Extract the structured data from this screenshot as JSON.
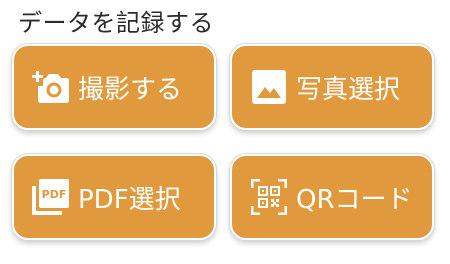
{
  "header": {
    "title": "データを記録する"
  },
  "buttons": {
    "camera": {
      "label": "撮影する",
      "icon": "add-camera-icon"
    },
    "photo": {
      "label": "写真選択",
      "icon": "image-icon"
    },
    "pdf": {
      "label": "PDF選択",
      "icon": "pdf-icon",
      "icon_text": "PDF"
    },
    "qr": {
      "label": "QRコード",
      "icon": "qr-scan-icon"
    }
  },
  "colors": {
    "button_bg": "#E09A3D",
    "button_text": "#FFFFFF",
    "title_text": "#2B2B2B"
  }
}
